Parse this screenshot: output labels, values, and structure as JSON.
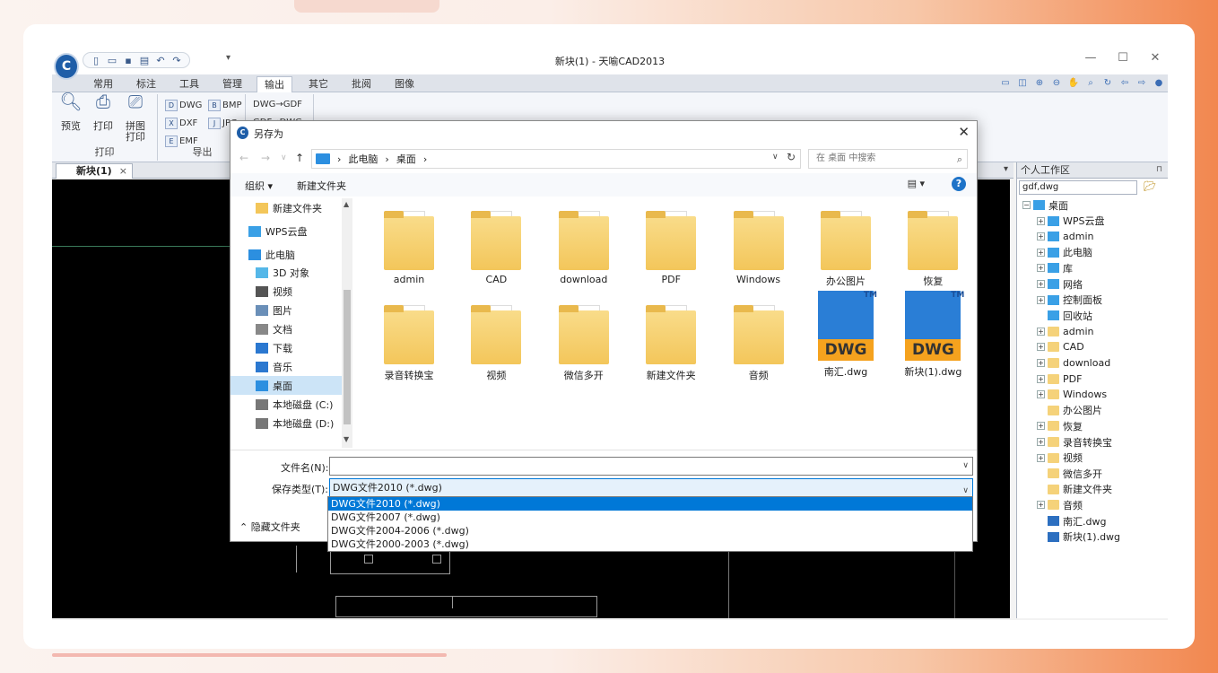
{
  "window": {
    "title": "新块(1) - 天喻CAD2013"
  },
  "ribbon": {
    "tabs": [
      "常用",
      "标注",
      "工具",
      "管理",
      "输出",
      "其它",
      "批阅",
      "图像"
    ],
    "groups": {
      "print": {
        "label": "打印",
        "preview": "预览",
        "print": "打印",
        "tile_print": "拼图\n打印"
      },
      "export": {
        "label": "导出",
        "dwg": "DWG",
        "bmp": "BMP",
        "dxf": "DXF",
        "jpg": "JPG",
        "emf": "EMF"
      },
      "convert": {
        "dwg_gdf": "DWG→GDF",
        "gdf_dwg": "GDF→DWG"
      }
    }
  },
  "doc_tab": {
    "label": "新块(1)",
    "close": "×"
  },
  "right_panel": {
    "title": "个人工作区",
    "search_value": "gdf,dwg",
    "tree": [
      {
        "label": "桌面",
        "level": 0,
        "icon": "desktop-icon",
        "expander": "⊟"
      },
      {
        "label": "WPS云盘",
        "level": 1,
        "icon": "cloud-icon",
        "expander": "⊞"
      },
      {
        "label": "admin",
        "level": 1,
        "icon": "user-icon",
        "expander": "⊞"
      },
      {
        "label": "此电脑",
        "level": 1,
        "icon": "computer-icon",
        "expander": "⊞"
      },
      {
        "label": "库",
        "level": 1,
        "icon": "library-icon",
        "expander": "⊞"
      },
      {
        "label": "网络",
        "level": 1,
        "icon": "network-icon",
        "expander": "⊞"
      },
      {
        "label": "控制面板",
        "level": 1,
        "icon": "control-panel-icon",
        "expander": "⊞"
      },
      {
        "label": "回收站",
        "level": 1,
        "icon": "recycle-bin-icon",
        "expander": ""
      },
      {
        "label": "admin",
        "level": 1,
        "icon": "folder-icon",
        "expander": "⊞"
      },
      {
        "label": "CAD",
        "level": 1,
        "icon": "folder-icon",
        "expander": "⊞"
      },
      {
        "label": "download",
        "level": 1,
        "icon": "folder-icon",
        "expander": "⊞"
      },
      {
        "label": "PDF",
        "level": 1,
        "icon": "folder-icon",
        "expander": "⊞"
      },
      {
        "label": "Windows",
        "level": 1,
        "icon": "folder-icon",
        "expander": "⊞"
      },
      {
        "label": "办公图片",
        "level": 1,
        "icon": "folder-icon",
        "expander": ""
      },
      {
        "label": "恢复",
        "level": 1,
        "icon": "folder-icon",
        "expander": "⊞"
      },
      {
        "label": "录音转换宝",
        "level": 1,
        "icon": "folder-icon",
        "expander": "⊞"
      },
      {
        "label": "视频",
        "level": 1,
        "icon": "folder-icon",
        "expander": "⊞"
      },
      {
        "label": "微信多开",
        "level": 1,
        "icon": "folder-icon",
        "expander": ""
      },
      {
        "label": "新建文件夹",
        "level": 1,
        "icon": "folder-icon",
        "expander": ""
      },
      {
        "label": "音频",
        "level": 1,
        "icon": "folder-icon",
        "expander": "⊞"
      },
      {
        "label": "南汇.dwg",
        "level": 1,
        "icon": "dwg-file-icon",
        "expander": ""
      },
      {
        "label": "新块(1).dwg",
        "level": 1,
        "icon": "dwg-file-icon",
        "expander": ""
      }
    ]
  },
  "dialog": {
    "title": "另存为",
    "breadcrumb": [
      "此电脑",
      "桌面"
    ],
    "search_placeholder": "在 桌面 中搜索",
    "commands": {
      "organize": "组织 ▾",
      "new_folder": "新建文件夹"
    },
    "nav": [
      {
        "label": "新建文件夹",
        "icon": "folder-icon",
        "selected": false
      },
      {
        "label": "WPS云盘",
        "icon": "cloud-icon",
        "selected": false
      },
      {
        "label": "此电脑",
        "icon": "computer-icon",
        "selected": false
      },
      {
        "label": "3D 对象",
        "icon": "3d-objects-icon",
        "selected": false
      },
      {
        "label": "视频",
        "icon": "video-icon",
        "selected": false
      },
      {
        "label": "图片",
        "icon": "pictures-icon",
        "selected": false
      },
      {
        "label": "文档",
        "icon": "documents-icon",
        "selected": false
      },
      {
        "label": "下载",
        "icon": "download-icon",
        "selected": false
      },
      {
        "label": "音乐",
        "icon": "music-icon",
        "selected": false
      },
      {
        "label": "桌面",
        "icon": "desktop-icon",
        "selected": true
      },
      {
        "label": "本地磁盘 (C:)",
        "icon": "drive-icon",
        "selected": false
      },
      {
        "label": "本地磁盘 (D:)",
        "icon": "drive-icon",
        "selected": false
      }
    ],
    "files": [
      {
        "name": "admin",
        "kind": "folder"
      },
      {
        "name": "CAD",
        "kind": "folder"
      },
      {
        "name": "download",
        "kind": "folder"
      },
      {
        "name": "PDF",
        "kind": "folder"
      },
      {
        "name": "Windows",
        "kind": "folder"
      },
      {
        "name": "办公图片",
        "kind": "folder"
      },
      {
        "name": "恢复",
        "kind": "folder"
      },
      {
        "name": "录音转换宝",
        "kind": "folder"
      },
      {
        "name": "视频",
        "kind": "folder"
      },
      {
        "name": "微信多开",
        "kind": "folder"
      },
      {
        "name": "新建文件夹",
        "kind": "folder"
      },
      {
        "name": "音频",
        "kind": "folder"
      },
      {
        "name": "南汇.dwg",
        "kind": "dwg"
      },
      {
        "name": "新块(1).dwg",
        "kind": "dwg"
      }
    ],
    "filename_label": "文件名(N):",
    "filename_value": "",
    "filetype_label": "保存类型(T):",
    "filetype_value": "DWG文件2010 (*.dwg)",
    "filetype_options": [
      "DWG文件2010 (*.dwg)",
      "DWG文件2007 (*.dwg)",
      "DWG文件2004-2006 (*.dwg)",
      "DWG文件2000-2003 (*.dwg)"
    ],
    "hide_folders": "隐藏文件夹"
  },
  "colors": {
    "accent": "#0078d7",
    "folder": "#f3c65a",
    "dwg": "#2a7ed6",
    "dwg_band": "#f5a21e"
  }
}
